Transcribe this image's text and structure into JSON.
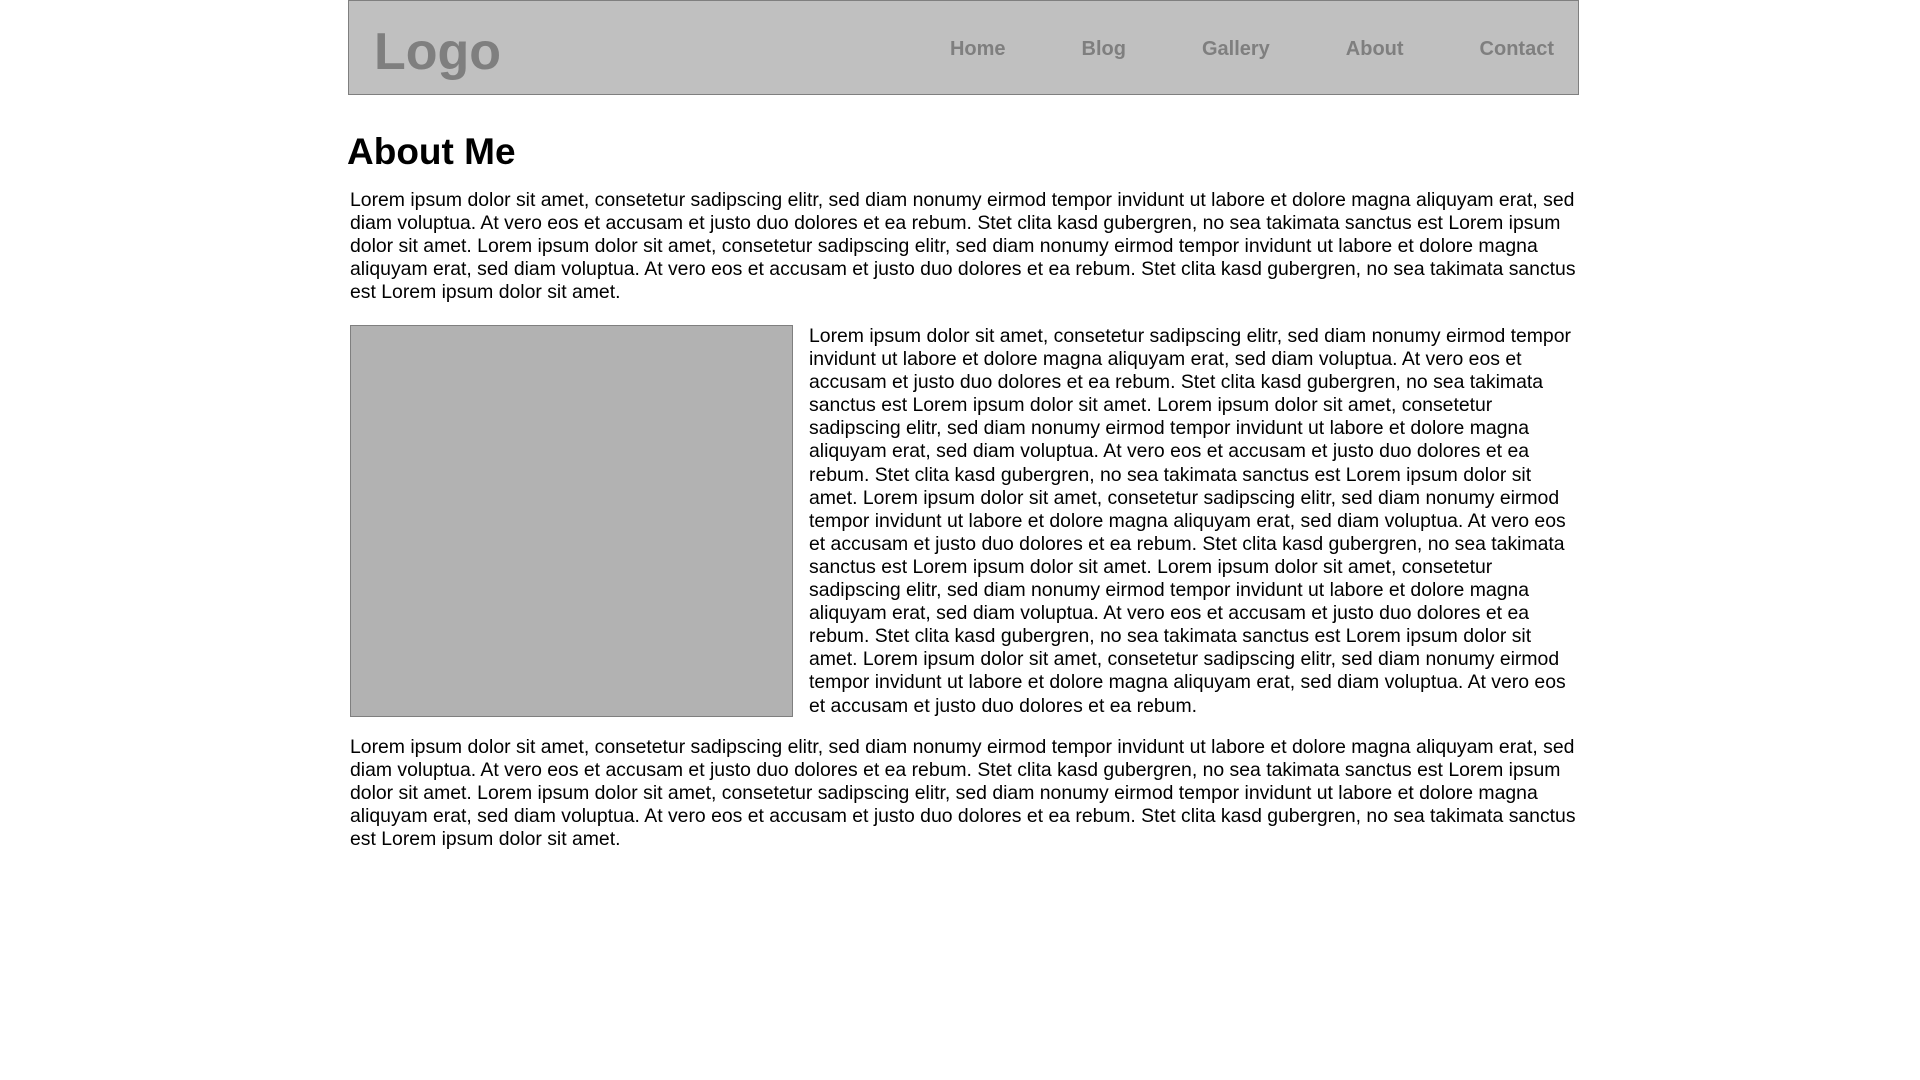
{
  "header": {
    "logo": "Logo",
    "nav": [
      {
        "label": "Home"
      },
      {
        "label": "Blog"
      },
      {
        "label": "Gallery"
      },
      {
        "label": "About"
      },
      {
        "label": "Contact"
      }
    ]
  },
  "main": {
    "title": "About Me",
    "paragraphs": [
      "Lorem ipsum dolor sit amet, consetetur sadipscing elitr, sed diam nonumy eirmod tempor invidunt ut labore et dolore magna aliquyam erat, sed diam voluptua. At vero eos et accusam et justo duo dolores et ea rebum. Stet clita kasd gubergren, no sea takimata sanctus est Lorem ipsum dolor sit amet. Lorem ipsum dolor sit amet, consetetur sadipscing elitr, sed diam nonumy eirmod tempor invidunt ut labore et dolore magna aliquyam erat, sed diam voluptua. At vero eos et accusam et justo duo dolores et ea rebum. Stet clita kasd gubergren, no sea takimata sanctus est Lorem ipsum dolor sit amet.",
      "Lorem ipsum dolor sit amet, consetetur sadipscing elitr, sed diam nonumy eirmod tempor invidunt ut labore et dolore magna aliquyam erat, sed diam voluptua. At vero eos et accusam et justo duo dolores et ea rebum. Stet clita kasd gubergren, no sea takimata sanctus est Lorem ipsum dolor sit amet. Lorem ipsum dolor sit amet, consetetur sadipscing elitr, sed diam nonumy eirmod tempor invidunt ut labore et dolore magna aliquyam erat, sed diam voluptua. At vero eos et accusam et justo duo dolores et ea rebum. Stet clita kasd gubergren, no sea takimata sanctus est Lorem ipsum dolor sit amet. Lorem ipsum dolor sit amet, consetetur sadipscing elitr, sed diam nonumy eirmod tempor invidunt ut labore et dolore magna aliquyam erat, sed diam voluptua. At vero eos et accusam et justo duo dolores et ea rebum. Stet clita kasd gubergren, no sea takimata sanctus est Lorem ipsum dolor sit amet. Lorem ipsum dolor sit amet, consetetur sadipscing elitr, sed diam nonumy eirmod tempor invidunt ut labore et dolore magna aliquyam erat, sed diam voluptua. At vero eos et accusam et justo duo dolores et ea rebum. Stet clita kasd gubergren, no sea takimata sanctus est Lorem ipsum dolor sit amet. Lorem ipsum dolor sit amet, consetetur sadipscing elitr, sed diam nonumy eirmod tempor invidunt ut labore et dolore magna aliquyam erat, sed diam voluptua. At vero eos et accusam et justo duo dolores et ea rebum.",
      "Lorem ipsum dolor sit amet, consetetur sadipscing elitr, sed diam nonumy eirmod tempor invidunt ut labore et dolore magna aliquyam erat, sed diam voluptua. At vero eos et accusam et justo duo dolores et ea rebum. Stet clita kasd gubergren, no sea takimata sanctus est Lorem ipsum dolor sit amet. Lorem ipsum dolor sit amet, consetetur sadipscing elitr, sed diam nonumy eirmod tempor invidunt ut labore et dolore magna aliquyam erat, sed diam voluptua. At vero eos et accusam et justo duo dolores et ea rebum. Stet clita kasd gubergren, no sea takimata sanctus est Lorem ipsum dolor sit amet."
    ]
  },
  "colors": {
    "header_bg": "#c0c0c0",
    "header_text": "#7f7f7f",
    "image_placeholder": "#b2b2b2"
  }
}
